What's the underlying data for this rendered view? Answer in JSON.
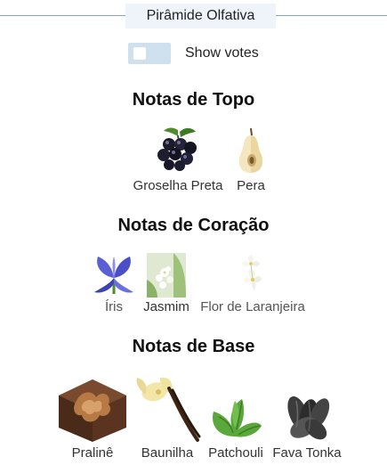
{
  "header": {
    "title": "Pirâmide Olfativa"
  },
  "toggle": {
    "label": "Show votes",
    "on": false
  },
  "sections": [
    {
      "title": "Notas de Topo",
      "notes": [
        {
          "label": "Groselha Preta",
          "icon": "blackcurrant-icon"
        },
        {
          "label": "Pera",
          "icon": "pear-icon"
        }
      ]
    },
    {
      "title": "Notas de Coração",
      "notes": [
        {
          "label": "Íris",
          "icon": "iris-icon"
        },
        {
          "label": "Jasmim",
          "icon": "jasmine-icon"
        },
        {
          "label": "Flor de Laranjeira",
          "icon": "orange-blossom-icon"
        }
      ]
    },
    {
      "title": "Notas de Base",
      "notes": [
        {
          "label": "Pralinê",
          "icon": "praline-icon"
        },
        {
          "label": "Baunilha",
          "icon": "vanilla-icon"
        },
        {
          "label": "Patchouli",
          "icon": "patchouli-icon"
        },
        {
          "label": "Fava Tonka",
          "icon": "tonka-bean-icon"
        }
      ]
    }
  ]
}
